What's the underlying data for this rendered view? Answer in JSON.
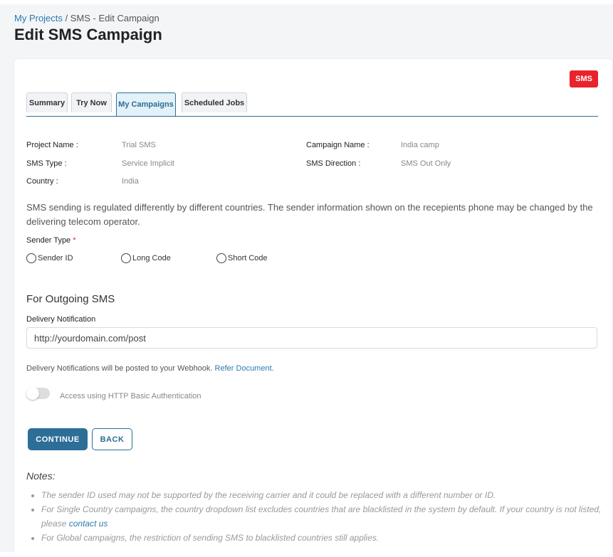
{
  "breadcrumb": {
    "root": "My Projects",
    "separator": " / ",
    "current": "SMS - Edit Campaign"
  },
  "page_title": "Edit SMS Campaign",
  "badge": "SMS",
  "tabs": [
    {
      "label": "Summary",
      "active": false
    },
    {
      "label": "Try Now",
      "active": false
    },
    {
      "label": "My Campaigns",
      "active": true
    },
    {
      "label": "Scheduled Jobs",
      "active": false
    }
  ],
  "info": {
    "project_name": {
      "label": "Project Name :",
      "value": "Trial SMS"
    },
    "campaign_name": {
      "label": "Campaign Name :",
      "value": "India camp"
    },
    "sms_type": {
      "label": "SMS Type :",
      "value": "Service Implicit"
    },
    "sms_direction": {
      "label": "SMS Direction :",
      "value": "SMS Out Only"
    },
    "country": {
      "label": "Country :",
      "value": "India"
    }
  },
  "regulation_note": "SMS sending is regulated differently by different countries. The sender information shown on the recepients phone may be changed by the delivering telecom operator.",
  "sender_type": {
    "label": "Sender Type",
    "required_mark": "*",
    "options": [
      "Sender ID",
      "Long Code",
      "Short Code"
    ]
  },
  "outgoing": {
    "title": "For Outgoing SMS",
    "delivery_label": "Delivery Notification",
    "delivery_value": "http://yourdomain.com/post",
    "webhook_note": "Delivery Notifications will be posted to your Webhook.",
    "refer_link": "Refer Document.",
    "auth_label": "Access using HTTP Basic Authentication",
    "auth_enabled": false
  },
  "buttons": {
    "continue": "CONTINUE",
    "back": "BACK"
  },
  "notes": {
    "title": "Notes:",
    "item1": "The sender ID used may not be supported by the receiving carrier and it could be replaced with a different number or ID.",
    "item2_text": "For Single Country campaigns, the country dropdown list excludes countries that are blacklisted in the system by default. If your country is not listed, please",
    "item2_link": "contact us",
    "item3": "For Global campaigns, the restriction of sending SMS to blacklisted countries still applies."
  },
  "colors": {
    "accent": "#2c6e97",
    "badge": "#e8232b",
    "link": "#2c7ab0",
    "background": "#f3f5f7"
  }
}
